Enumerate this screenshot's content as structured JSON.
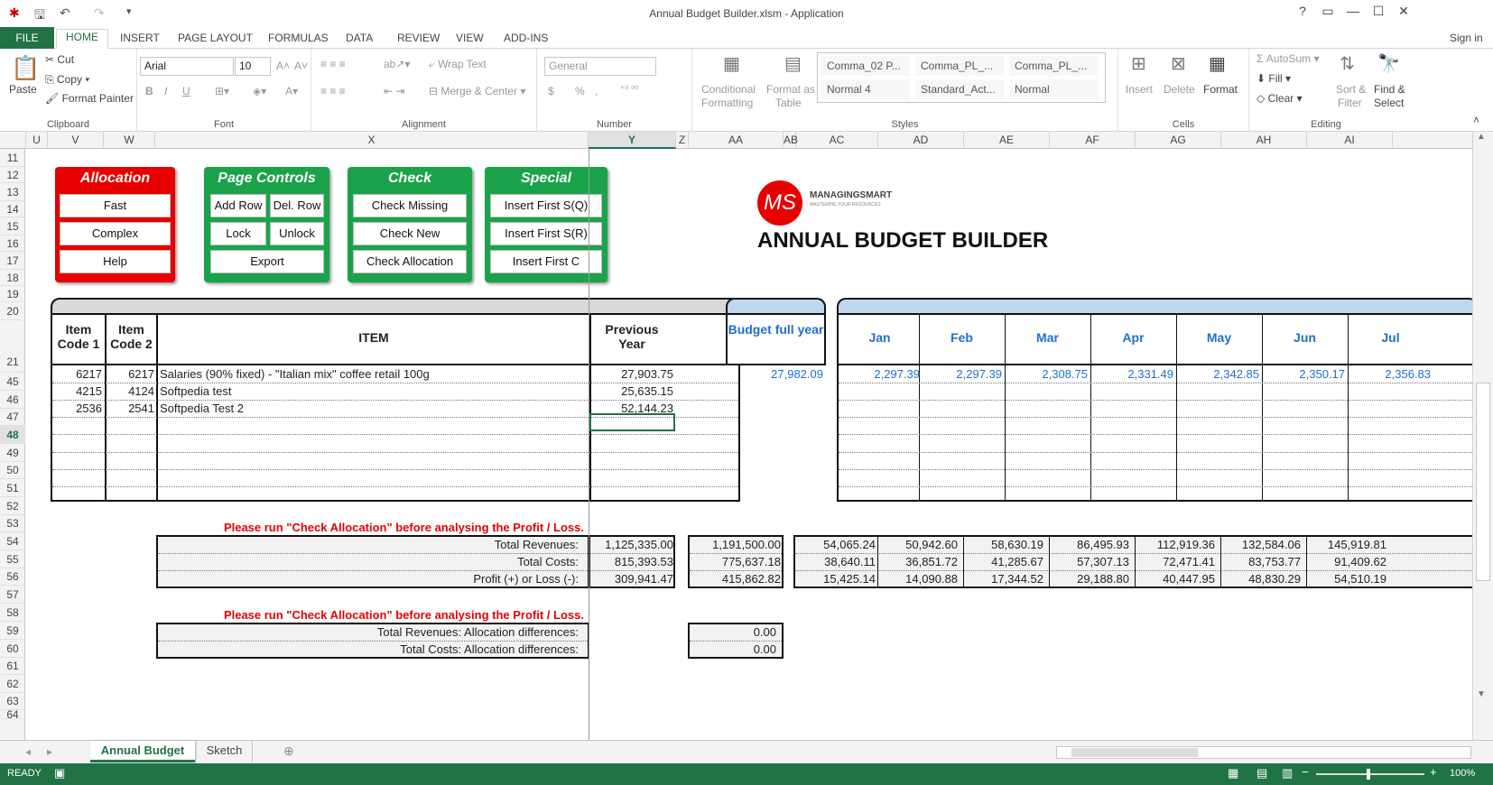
{
  "window": {
    "title": "Annual Budget Builder.xlsm - Application",
    "help": "?",
    "signin": "Sign in"
  },
  "tabs": [
    "FILE",
    "HOME",
    "INSERT",
    "PAGE LAYOUT",
    "FORMULAS",
    "DATA",
    "REVIEW",
    "VIEW",
    "ADD-INS"
  ],
  "ribbon": {
    "clipboard": {
      "paste": "Paste",
      "cut": "Cut",
      "copy": "Copy",
      "format_painter": "Format Painter",
      "label": "Clipboard"
    },
    "font": {
      "name": "Arial",
      "size": "10",
      "label": "Font",
      "bold": "B",
      "italic": "I",
      "underline": "U"
    },
    "alignment": {
      "wrap": "Wrap Text",
      "merge": "Merge & Center",
      "label": "Alignment"
    },
    "number": {
      "format": "General",
      "currency": "$",
      "percent": "%",
      "comma": ",",
      "label": "Number"
    },
    "styles": {
      "conditional": "Conditional",
      "conditional2": "Formatting",
      "format_as": "Format as",
      "format_as2": "Table",
      "label": "Styles",
      "cells": [
        "Comma_02 P...",
        "Comma_PL_...",
        "Comma_PL_...",
        "Normal 4",
        "Standard_Act...",
        "Normal"
      ]
    },
    "cells": {
      "insert": "Insert",
      "delete": "Delete",
      "format": "Format",
      "label": "Cells"
    },
    "editing": {
      "autosum": "AutoSum",
      "fill": "Fill",
      "clear": "Clear",
      "sort": "Sort &",
      "sort2": "Filter",
      "find": "Find &",
      "find2": "Select",
      "label": "Editing"
    }
  },
  "columns": [
    {
      "n": "U",
      "w": 24
    },
    {
      "n": "V",
      "w": 62
    },
    {
      "n": "W",
      "w": 57
    },
    {
      "n": "X",
      "w": 480
    },
    {
      "n": "Y",
      "w": 97
    },
    {
      "n": "Z",
      "w": 14
    },
    {
      "n": "AA",
      "w": 105
    },
    {
      "n": "AB",
      "w": 14
    },
    {
      "n": "AC",
      "w": 91
    },
    {
      "n": "AD",
      "w": 95
    },
    {
      "n": "AE",
      "w": 95
    },
    {
      "n": "AF",
      "w": 95
    },
    {
      "n": "AG",
      "w": 95
    },
    {
      "n": "AH",
      "w": 95
    },
    {
      "n": "AI",
      "w": 95
    }
  ],
  "selected_col": "Y",
  "rows": [
    {
      "n": "11",
      "h": 20
    },
    {
      "n": "12",
      "h": 18
    },
    {
      "n": "13",
      "h": 20
    },
    {
      "n": "14",
      "h": 18
    },
    {
      "n": "15",
      "h": 20
    },
    {
      "n": "16",
      "h": 18
    },
    {
      "n": "17",
      "h": 20
    },
    {
      "n": "18",
      "h": 18
    },
    {
      "n": "19",
      "h": 18
    },
    {
      "n": "20",
      "h": 20
    },
    {
      "n": "21",
      "h": 58
    },
    {
      "n": "45",
      "h": 20
    },
    {
      "n": "46",
      "h": 20
    },
    {
      "n": "47",
      "h": 19
    },
    {
      "n": "48",
      "h": 20
    },
    {
      "n": "49",
      "h": 20
    },
    {
      "n": "50",
      "h": 19
    },
    {
      "n": "51",
      "h": 20
    },
    {
      "n": "52",
      "h": 20
    },
    {
      "n": "53",
      "h": 19
    },
    {
      "n": "54",
      "h": 20
    },
    {
      "n": "55",
      "h": 20
    },
    {
      "n": "56",
      "h": 19
    },
    {
      "n": "57",
      "h": 20
    },
    {
      "n": "58",
      "h": 20
    },
    {
      "n": "59",
      "h": 20
    },
    {
      "n": "60",
      "h": 20
    },
    {
      "n": "61",
      "h": 19
    },
    {
      "n": "62",
      "h": 20
    },
    {
      "n": "63",
      "h": 19
    },
    {
      "n": "64",
      "h": 10
    }
  ],
  "selected_row": "48",
  "panels": {
    "allocation": {
      "title": "Allocation",
      "buttons": [
        "Fast",
        "Complex",
        "Help"
      ]
    },
    "page_controls": {
      "title": "Page Controls",
      "buttons": [
        "Add Row",
        "Del. Row",
        "Lock",
        "Unlock",
        "Export"
      ]
    },
    "check": {
      "title": "Check",
      "buttons": [
        "Check Missing",
        "Check New",
        "Check Allocation"
      ]
    },
    "special": {
      "title": "Special",
      "buttons": [
        "Insert First S(Q)",
        "Insert First S(R)",
        "Insert First C"
      ]
    }
  },
  "brand": {
    "logo_initials": "MS",
    "logo_name": "MANAGINGSMART",
    "logo_tag": "MASTERING YOUR RESOURCES",
    "title": "ANNUAL BUDGET BUILDER"
  },
  "headers": {
    "code1": "Item Code 1",
    "code2": "Item Code 2",
    "item": "ITEM",
    "prev": "Previous Year",
    "budget": "Budget full year",
    "months": [
      "Jan",
      "Feb",
      "Mar",
      "Apr",
      "May",
      "Jun",
      "Jul"
    ]
  },
  "data_rows": [
    {
      "c1": "6217",
      "c2": "6217",
      "item": "Salaries  (90% fixed) - \"Italian mix\" coffee retail 100g",
      "prev": "27,903.75",
      "budget": "27,982.09",
      "months": [
        "2,297.39",
        "2,297.39",
        "2,308.75",
        "2,331.49",
        "2,342.85",
        "2,350.17",
        "2,356.83"
      ]
    },
    {
      "c1": "4215",
      "c2": "4124",
      "item": "Softpedia test",
      "prev": "25,635.15",
      "budget": "",
      "months": []
    },
    {
      "c1": "2536",
      "c2": "2541",
      "item": "Softpedia Test 2",
      "prev": "52,144.23",
      "budget": "",
      "months": []
    }
  ],
  "warning": "Please run \"Check Allocation\" before analysing the Profit / Loss.",
  "totals": [
    {
      "label": "Total Revenues:",
      "prev": "1,125,335.00",
      "budget": "1,191,500.00",
      "months": [
        "54,065.24",
        "50,942.60",
        "58,630.19",
        "86,495.93",
        "112,919.36",
        "132,584.06",
        "145,919.81"
      ]
    },
    {
      "label": "Total Costs:",
      "prev": "815,393.53",
      "budget": "775,637.18",
      "months": [
        "38,640.11",
        "36,851.72",
        "41,285.67",
        "57,307.13",
        "72,471.41",
        "83,753.77",
        "91,409.62"
      ]
    },
    {
      "label": "Profit (+) or Loss (-):",
      "prev": "309,941.47",
      "budget": "415,862.82",
      "months": [
        "15,425.14",
        "14,090.88",
        "17,344.52",
        "29,188.80",
        "40,447.95",
        "48,830.29",
        "54,510.19"
      ]
    }
  ],
  "alloc_diff": [
    {
      "label": "Total Revenues: Allocation differences:",
      "value": "0.00"
    },
    {
      "label": "Total Costs: Allocation differences:",
      "value": "0.00"
    }
  ],
  "sheets": [
    "Annual Budget",
    "Sketch"
  ],
  "status": {
    "ready": "READY",
    "zoom": "100%"
  },
  "colors": {
    "excel_green": "#217346",
    "alloc_red": "#e60000",
    "panel_green": "#1aa34a",
    "value_blue": "#1f6fd1"
  }
}
